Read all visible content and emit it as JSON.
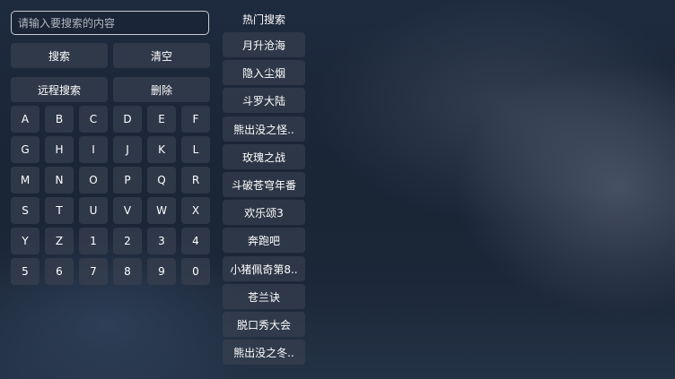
{
  "search": {
    "value": "",
    "placeholder": "请输入要搜索的内容"
  },
  "actions": {
    "search_label": "搜索",
    "clear_label": "清空",
    "remote_search_label": "远程搜索",
    "delete_label": "删除"
  },
  "keyboard": {
    "keys": [
      "A",
      "B",
      "C",
      "D",
      "E",
      "F",
      "G",
      "H",
      "I",
      "J",
      "K",
      "L",
      "M",
      "N",
      "O",
      "P",
      "Q",
      "R",
      "S",
      "T",
      "U",
      "V",
      "W",
      "X",
      "Y",
      "Z",
      "1",
      "2",
      "3",
      "4",
      "5",
      "6",
      "7",
      "8",
      "9",
      "0"
    ]
  },
  "hot": {
    "title": "热门搜索",
    "items": [
      "月升沧海",
      "隐入尘烟",
      "斗罗大陆",
      "熊出没之怪..",
      "玫瑰之战",
      "斗破苍穹年番",
      "欢乐颂3",
      "奔跑吧",
      "小猪佩奇第8..",
      "苍兰诀",
      "脱口秀大会",
      "熊出没之冬.."
    ]
  }
}
